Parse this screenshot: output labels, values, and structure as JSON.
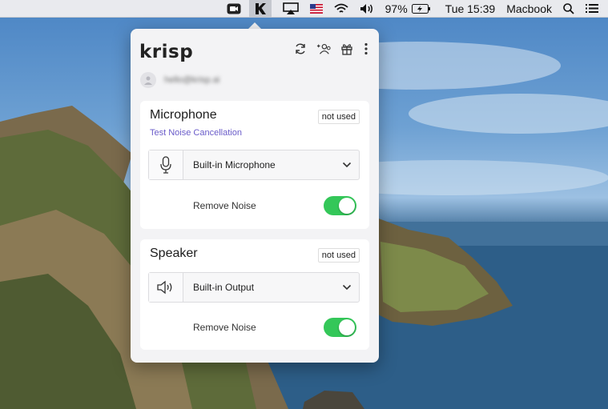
{
  "menubar": {
    "battery": "97%",
    "clock": "Tue 15:39",
    "host": "Macbook",
    "icons": [
      "zoom-icon",
      "krisp-icon",
      "airplay-icon",
      "us-flag-icon",
      "wifi-icon",
      "volume-icon",
      "battery-icon",
      "spotlight-icon",
      "control-center-icon"
    ]
  },
  "popover": {
    "logo": "krisp",
    "header_icons": [
      "refresh-icon",
      "add-user-icon",
      "gift-icon",
      "more-icon"
    ],
    "account_email": "hello@krisp.ai",
    "microphone": {
      "title": "Microphone",
      "status": "not used",
      "test_link": "Test Noise Cancellation",
      "device": "Built-in Microphone",
      "toggle_label": "Remove Noise",
      "toggle_on": true
    },
    "speaker": {
      "title": "Speaker",
      "status": "not used",
      "device": "Built-in Output",
      "toggle_label": "Remove Noise",
      "toggle_on": true
    }
  },
  "colors": {
    "accent_green": "#34c759",
    "link_purple": "#6a5cc9"
  }
}
